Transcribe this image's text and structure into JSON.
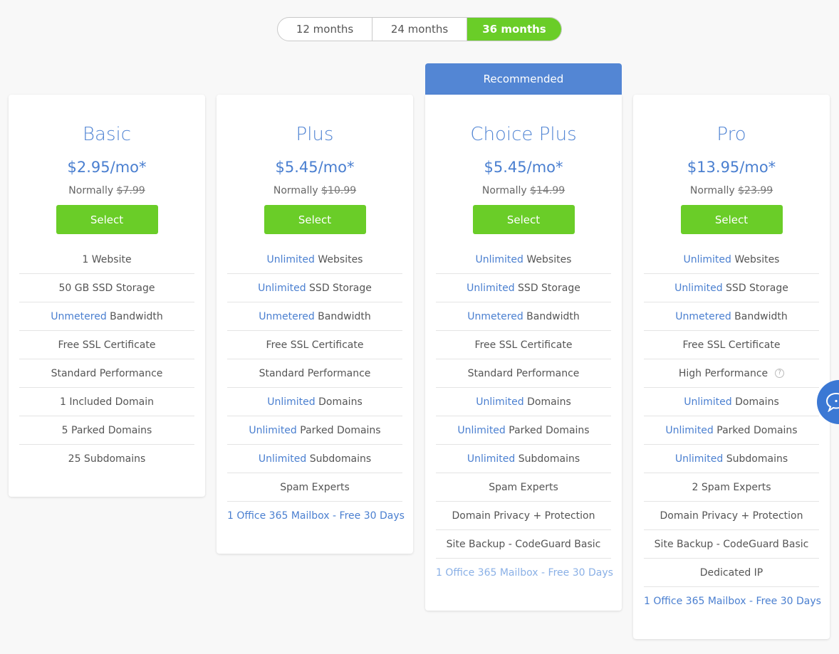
{
  "term_toggle": {
    "options": [
      "12 months",
      "24 months",
      "36 months"
    ],
    "selected": "36 months"
  },
  "colors": {
    "accent_blue": "#5386d4",
    "select_green": "#6acd28",
    "chat_blue": "#3b78d4"
  },
  "ribbon": "Recommended",
  "plans": [
    {
      "name": "Basic",
      "price": "$2.95/mo*",
      "normally_label": "Normally",
      "normal_price": "$7.99",
      "select_label": "Select",
      "features": [
        {
          "hl": "",
          "text": "1 Website"
        },
        {
          "hl": "",
          "text": "50 GB SSD Storage"
        },
        {
          "hl": "Unmetered",
          "text": " Bandwidth"
        },
        {
          "hl": "",
          "text": "Free SSL Certificate"
        },
        {
          "hl": "",
          "text": "Standard Performance"
        },
        {
          "hl": "",
          "text": "1 Included Domain"
        },
        {
          "hl": "",
          "text": "5 Parked Domains"
        },
        {
          "hl": "",
          "text": "25 Subdomains"
        }
      ]
    },
    {
      "name": "Plus",
      "price": "$5.45/mo*",
      "normally_label": "Normally",
      "normal_price": "$10.99",
      "select_label": "Select",
      "features": [
        {
          "hl": "Unlimited",
          "text": " Websites"
        },
        {
          "hl": "Unlimited",
          "text": " SSD Storage"
        },
        {
          "hl": "Unmetered",
          "text": " Bandwidth"
        },
        {
          "hl": "",
          "text": "Free SSL Certificate"
        },
        {
          "hl": "",
          "text": "Standard Performance"
        },
        {
          "hl": "Unlimited",
          "text": " Domains"
        },
        {
          "hl": "Unlimited",
          "text": " Parked Domains"
        },
        {
          "hl": "Unlimited",
          "text": " Subdomains"
        },
        {
          "hl": "",
          "text": "Spam Experts"
        },
        {
          "link": "1 Office 365 Mailbox - Free 30 Days"
        }
      ]
    },
    {
      "name": "Choice Plus",
      "price": "$5.45/mo*",
      "normally_label": "Normally",
      "normal_price": "$14.99",
      "select_label": "Select",
      "features": [
        {
          "hl": "Unlimited",
          "text": " Websites"
        },
        {
          "hl": "Unlimited",
          "text": " SSD Storage"
        },
        {
          "hl": "Unmetered",
          "text": " Bandwidth"
        },
        {
          "hl": "",
          "text": "Free SSL Certificate"
        },
        {
          "hl": "",
          "text": "Standard Performance"
        },
        {
          "hl": "Unlimited",
          "text": " Domains"
        },
        {
          "hl": "Unlimited",
          "text": " Parked Domains"
        },
        {
          "hl": "Unlimited",
          "text": " Subdomains"
        },
        {
          "hl": "",
          "text": "Spam Experts"
        },
        {
          "hl": "",
          "text": "Domain Privacy + Protection"
        },
        {
          "hl": "",
          "text": "Site Backup - CodeGuard Basic"
        },
        {
          "link": "1 Office 365 Mailbox - Free 30 Days",
          "faded": true
        }
      ]
    },
    {
      "name": "Pro",
      "price": "$13.95/mo*",
      "normally_label": "Normally",
      "normal_price": "$23.99",
      "select_label": "Select",
      "features": [
        {
          "hl": "Unlimited",
          "text": " Websites"
        },
        {
          "hl": "Unlimited",
          "text": " SSD Storage"
        },
        {
          "hl": "Unmetered",
          "text": " Bandwidth"
        },
        {
          "hl": "",
          "text": "Free SSL Certificate"
        },
        {
          "hl": "",
          "text": "High Performance",
          "help": "?"
        },
        {
          "hl": "Unlimited",
          "text": " Domains"
        },
        {
          "hl": "Unlimited",
          "text": " Parked Domains"
        },
        {
          "hl": "Unlimited",
          "text": " Subdomains"
        },
        {
          "hl": "",
          "text": "2 Spam Experts"
        },
        {
          "hl": "",
          "text": "Domain Privacy + Protection"
        },
        {
          "hl": "",
          "text": "Site Backup - CodeGuard Basic"
        },
        {
          "hl": "",
          "text": "Dedicated IP"
        },
        {
          "link": "1 Office 365 Mailbox - Free 30 Days"
        }
      ]
    }
  ],
  "chat": {
    "icon": "chat-bubble-icon"
  }
}
